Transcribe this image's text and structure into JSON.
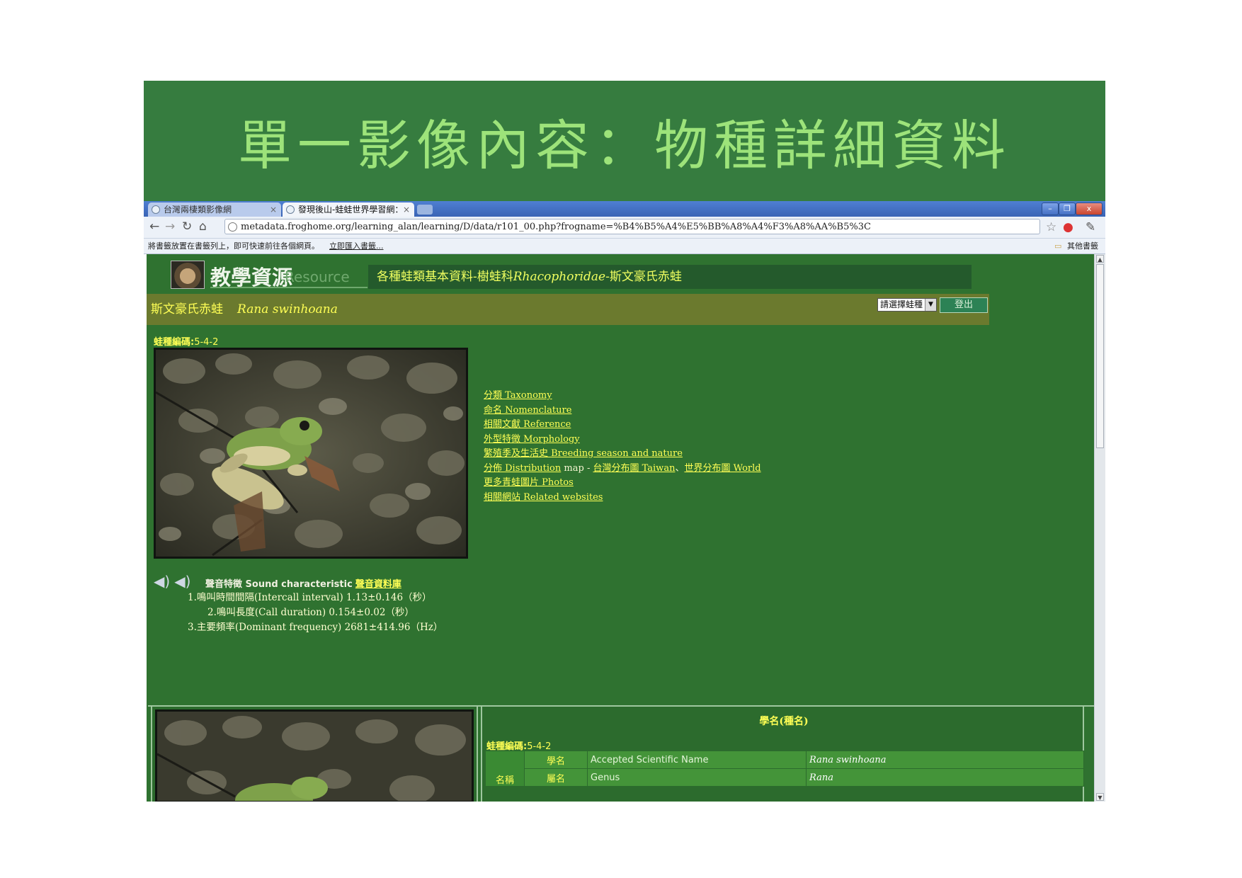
{
  "slide": {
    "title": "單一影像內容：物種詳細資料"
  },
  "browser": {
    "tabs": [
      {
        "label": "台灣兩棲類影像網"
      },
      {
        "label": "發現後山-蛙蛙世界學習網："
      }
    ],
    "window_controls": {
      "minimize": "–",
      "restore": "❐",
      "close": "x"
    },
    "url": "metadata.froghome.org/learning_alan/learning/D/data/r101_00.php?frogname=%B4%B5%A4%E5%BB%A8%A4%F3%A8%AA%B5%3C",
    "bookmarks_text": "將書籤放置在書籤列上，即可快速前往各個網頁。",
    "bookmarks_import": "立即匯入書籤...",
    "other_bookmarks": "其他書籤"
  },
  "page": {
    "resource_title": "教學資源",
    "resource_subtitle": "Resource",
    "header_prefix": "各種蛙類基本資料-樹蛙科",
    "header_family": "Rhacophoridae",
    "header_suffix": "-斯文豪氏赤蛙",
    "species_name": "斯文豪氏赤蛙",
    "species_sci": "Rana swinhoana",
    "select_label": "請選擇蛙種",
    "logout_label": "登出",
    "code_label": "蛙種編碼:",
    "code_value": "5-4-2",
    "links": {
      "taxonomy": "分類 Taxonomy",
      "nomenclature": "命名 Nomenclature",
      "reference": "相關文獻 Reference",
      "morphology": "外型特徵 Morphology",
      "breeding": "繁殖季及生活史 Breeding season and nature",
      "distribution": "分佈 Distribution",
      "map_text": "map -",
      "taiwan": "台灣分布圖 Taiwan",
      "sep": "、",
      "world": "世界分布圖 World",
      "photos": "更多青蛙圖片 Photos",
      "websites": "相關網站 Related websites"
    },
    "sound_label": "聲音特徵 Sound characteristic",
    "sound_db": "聲音資料庫",
    "stats": [
      "1.鳴叫時間間隔(Intercall interval) 1.13±0.146（秒）",
      "2.鳴叫長度(Call duration) 0.154±0.02（秒）",
      "3.主要頻率(Dominant frequency) 2681±414.96（Hz）"
    ],
    "info": {
      "title": "學名(種名)",
      "code_label": "蛙種編碼:",
      "code_value": "5-4-2",
      "name_cell": "名稱",
      "rows": [
        {
          "label": "學名",
          "en": "Accepted Scientific Name",
          "value": "Rana swinhoana"
        },
        {
          "label": "屬名",
          "en": "Genus",
          "value": "Rana"
        }
      ]
    }
  }
}
